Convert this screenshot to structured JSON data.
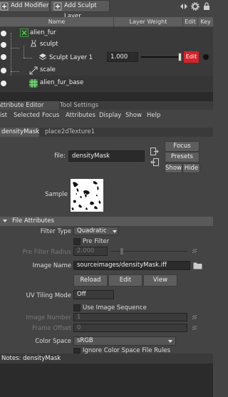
{
  "toolbar": {
    "add_modifier": "Add Modifier",
    "add_sculpt_layer": "Add Sculpt Layer"
  },
  "columns": {
    "name": "Name",
    "layer_weight": "Layer Weight",
    "edit": "Edit",
    "key": "Key"
  },
  "tree": {
    "alien_fur": "alien_fur",
    "sculpt": "sculpt",
    "sculpt_layer": "Sculpt Layer 1",
    "sculpt_layer_weight": "1.000",
    "sculpt_layer_weight_fraction": 1.0,
    "edit_button": "Edit",
    "scale": "scale",
    "alien_fur_base": "alien_fur_base"
  },
  "panel_tabs": {
    "attribute_editor": "Attribute Editor",
    "tool_settings": "Tool Settings"
  },
  "menu": [
    "ist",
    "Selected",
    "Focus",
    "Attributes",
    "Display",
    "Show",
    "Help"
  ],
  "node_tabs": {
    "active": "densityMask",
    "other": "place2dTexture1"
  },
  "file_row": {
    "label": "file:",
    "value": "densityMask"
  },
  "buttons": {
    "focus": "Focus",
    "presets": "Presets",
    "show": "Show",
    "hide": "Hide"
  },
  "sample_label": "Sample",
  "section": {
    "title": "File Attributes"
  },
  "filter_type": {
    "label": "Filter Type",
    "value": "Quadratic"
  },
  "pre_filter": {
    "label": "Pre Filter"
  },
  "pre_filter_radius": {
    "label": "Pre Filter Radius",
    "value": "2.000"
  },
  "image_name": {
    "label": "Image Name",
    "value": "sourceimages/densityMask.iff"
  },
  "action_buttons": {
    "reload": "Reload",
    "edit": "Edit",
    "view": "View"
  },
  "uv_tiling": {
    "label": "UV Tiling Mode",
    "value": "Off"
  },
  "use_image_sequence": {
    "label": "Use Image Sequence"
  },
  "image_number": {
    "label": "Image Number",
    "value": "1"
  },
  "frame_offset": {
    "label": "Frame Offset",
    "value": "0"
  },
  "color_space": {
    "label": "Color Space",
    "value": "sRGB"
  },
  "ignore_cs": {
    "label": "Ignore Color Space File Rules"
  },
  "notes": {
    "label": "Notes:  densityMask"
  },
  "colors": {
    "accent_red": "#d8222a",
    "background": "#444444",
    "field": "#2b2b2b",
    "header": "#5e5e5e"
  }
}
